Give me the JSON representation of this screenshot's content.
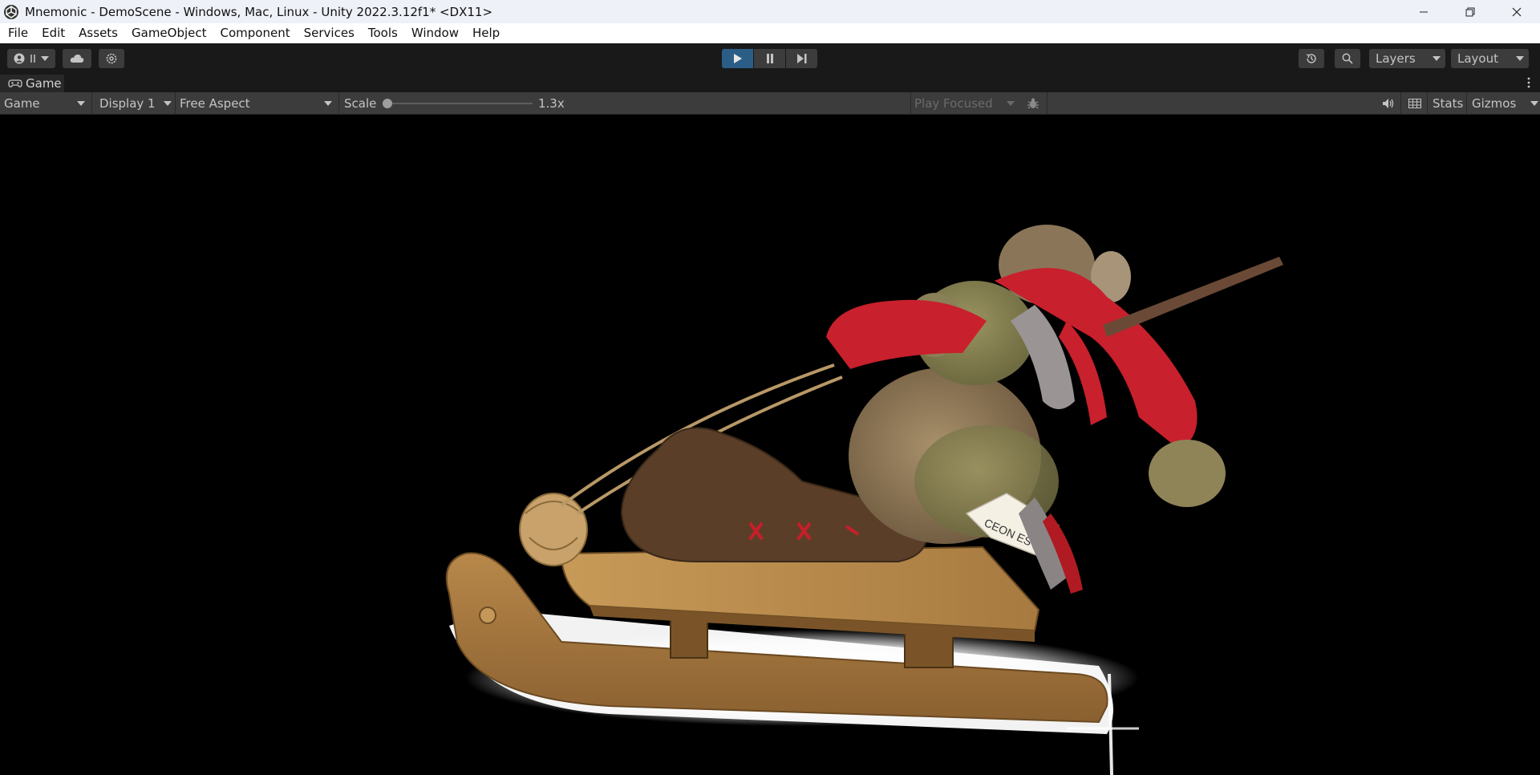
{
  "window": {
    "title": "Mnemonic - DemoScene - Windows, Mac, Linux - Unity 2022.3.12f1* <DX11>",
    "controls": [
      "minimize-icon",
      "restore-icon",
      "close-icon"
    ]
  },
  "menu": {
    "items": [
      "File",
      "Edit",
      "Assets",
      "GameObject",
      "Component",
      "Services",
      "Tools",
      "Window",
      "Help"
    ]
  },
  "toolbar": {
    "account_icon": "account-icon",
    "cloud_icon": "cloud-icon",
    "settings_icon": "settings-icon",
    "play_state": "playing",
    "history_icon": "history-icon",
    "search_icon": "search-icon",
    "layers_label": "Layers",
    "layout_label": "Layout",
    "accent_color": "#2c5d87"
  },
  "tab": {
    "label": "Game"
  },
  "game_toolbar": {
    "view_mode": "Game",
    "display": "Display 1",
    "aspect": "Free Aspect",
    "scale_label": "Scale",
    "scale_value": "1.3x",
    "play_mode": "Play Focused",
    "stats_label": "Stats",
    "gizmos_label": "Gizmos"
  },
  "scene": {
    "tag_text": "CEON ESTASA"
  }
}
